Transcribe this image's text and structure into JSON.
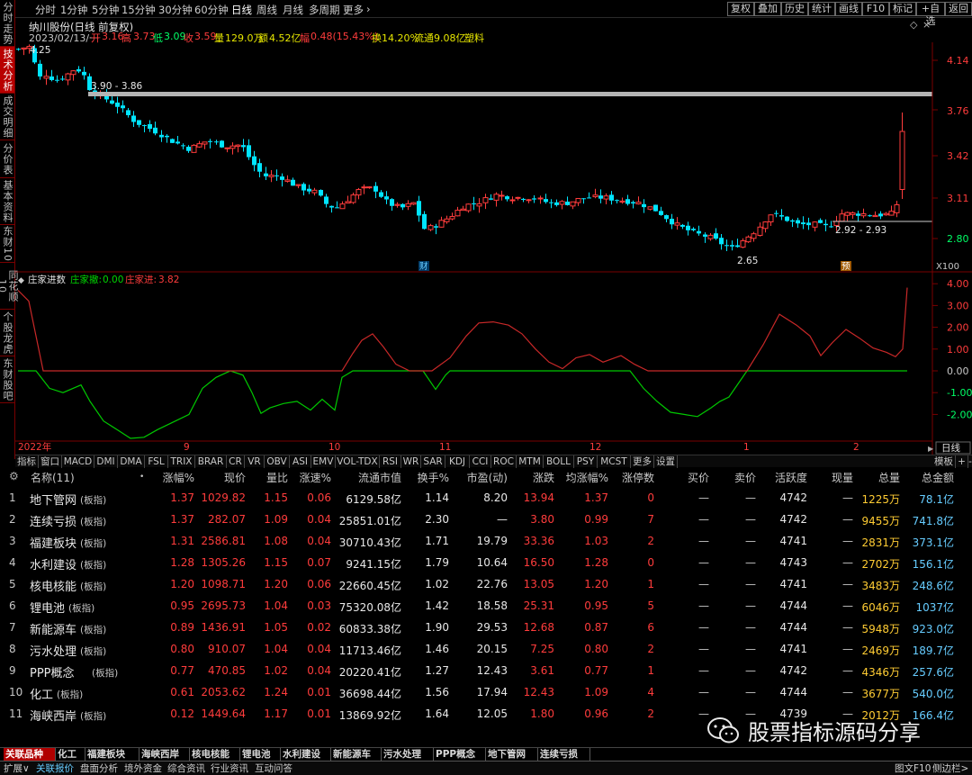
{
  "sidebar": {
    "items": [
      "分时走势",
      "技术分析",
      "成交明细",
      "分价表",
      "基本资料",
      "东财10",
      "同花顺10",
      "个股龙虎",
      "东财股吧"
    ],
    "active_index": 1
  },
  "topbar": {
    "periods": [
      "分时",
      "1分钟",
      "5分钟",
      "15分钟",
      "30分钟",
      "60分钟",
      "日线",
      "周线",
      "月线",
      "多周期",
      "更多"
    ],
    "active_period": "日线",
    "right_buttons": [
      "复权",
      "叠加",
      "历史",
      "统计",
      "画线",
      "F10",
      "标记",
      "+自选",
      "返回"
    ]
  },
  "stock": {
    "title": "纳川股份(日线 前复权)",
    "date": "2023/02/13/一",
    "open_label": "开",
    "open": "3.16",
    "high_label": "高",
    "high": "3.73",
    "low_label": "低",
    "low": "3.09",
    "close_label": "收",
    "close": "3.59",
    "vol_label": "量",
    "vol": "129.0万",
    "amt_label": "额",
    "amt": "4.52亿",
    "chg_label": "幅",
    "chg": "0.48(15.43%)",
    "turnover": "换14.20%",
    "float": "流通9.08亿",
    "industry": "塑料"
  },
  "main_chart": {
    "price_axis": [
      "4.14",
      "3.76",
      "3.42",
      "3.11",
      "2.80"
    ],
    "label_high": "4.25",
    "label_support": "3.90 - 3.86",
    "label_recent": "2.92 - 2.93",
    "label_low": "2.65",
    "marker_cai": "财",
    "marker_yu": "预",
    "zoom": "X100"
  },
  "indicator": {
    "name": "庄家进数",
    "series1_label": "庄家撤:",
    "series1_value": "0.00",
    "series2_label": "庄家进:",
    "series2_value": "3.82",
    "axis": [
      "4.00",
      "3.00",
      "2.00",
      "1.00",
      "0.00",
      "-1.00",
      "-2.00"
    ]
  },
  "time_axis": {
    "labels": [
      "2022年",
      "9",
      "10",
      "11",
      "12",
      "1",
      "2"
    ],
    "right": "日线"
  },
  "indicator_tabs": [
    "指标",
    "窗口",
    "MACD",
    "DMI",
    "DMA",
    "FSL",
    "TRIX",
    "BRAR",
    "CR",
    "VR",
    "OBV",
    "ASI",
    "EMV",
    "VOL-TDX",
    "RSI",
    "WR",
    "SAR",
    "KDJ",
    "CCI",
    "ROC",
    "MTM",
    "BOLL",
    "PSY",
    "MCST",
    "更多",
    "设置"
  ],
  "ind_tab_right": [
    "模板",
    "+",
    "-"
  ],
  "table": {
    "headers": [
      "名称(11)",
      "涨幅%",
      "现价",
      "量比",
      "涨速%",
      "流通市值",
      "换手%",
      "市盈(动)",
      "涨跌",
      "均涨幅%",
      "涨停数",
      "买价",
      "卖价",
      "活跃度",
      "现量",
      "总量",
      "总金额"
    ],
    "rows": [
      [
        "1",
        "地下管网",
        "(板指)",
        "1.37",
        "1029.82",
        "1.15",
        "0.06",
        "6129.58亿",
        "1.14",
        "8.20",
        "13.94",
        "1.37",
        "0",
        "—",
        "—",
        "4742",
        "—",
        "1225万",
        "78.1亿"
      ],
      [
        "2",
        "连续亏损",
        "(板指)",
        "1.37",
        "282.07",
        "1.09",
        "0.04",
        "25851.01亿",
        "2.30",
        "—",
        "3.80",
        "0.99",
        "7",
        "—",
        "—",
        "4742",
        "—",
        "9455万",
        "741.8亿"
      ],
      [
        "3",
        "福建板块",
        "(板指)",
        "1.31",
        "2586.81",
        "1.08",
        "0.04",
        "30710.43亿",
        "1.71",
        "19.79",
        "33.36",
        "1.03",
        "2",
        "—",
        "—",
        "4741",
        "—",
        "2831万",
        "373.1亿"
      ],
      [
        "4",
        "水利建设",
        "(板指)",
        "1.28",
        "1305.26",
        "1.15",
        "0.07",
        "9241.15亿",
        "1.79",
        "10.64",
        "16.50",
        "1.28",
        "0",
        "—",
        "—",
        "4743",
        "—",
        "2702万",
        "156.1亿"
      ],
      [
        "5",
        "核电核能",
        "(板指)",
        "1.20",
        "1098.71",
        "1.20",
        "0.06",
        "22660.45亿",
        "1.02",
        "22.76",
        "13.05",
        "1.20",
        "1",
        "—",
        "—",
        "4741",
        "—",
        "3483万",
        "248.6亿"
      ],
      [
        "6",
        "锂电池",
        "(板指)",
        "0.95",
        "2695.73",
        "1.04",
        "0.03",
        "75320.08亿",
        "1.42",
        "18.58",
        "25.31",
        "0.95",
        "5",
        "—",
        "—",
        "4744",
        "—",
        "6046万",
        "1037亿"
      ],
      [
        "7",
        "新能源车",
        "(板指)",
        "0.89",
        "1436.91",
        "1.05",
        "0.02",
        "60833.38亿",
        "1.90",
        "29.53",
        "12.68",
        "0.87",
        "6",
        "—",
        "—",
        "4744",
        "—",
        "5948万",
        "923.0亿"
      ],
      [
        "8",
        "污水处理",
        "(板指)",
        "0.80",
        "910.07",
        "1.04",
        "0.04",
        "11713.46亿",
        "1.46",
        "20.15",
        "7.25",
        "0.80",
        "2",
        "—",
        "—",
        "4741",
        "—",
        "2469万",
        "189.7亿"
      ],
      [
        "9",
        "PPP概念",
        "(板指)",
        "0.77",
        "470.85",
        "1.02",
        "0.04",
        "20220.41亿",
        "1.27",
        "12.43",
        "3.61",
        "0.77",
        "1",
        "—",
        "—",
        "4742",
        "—",
        "4346万",
        "257.6亿"
      ],
      [
        "10",
        "化工",
        "(板指)",
        "0.61",
        "2053.62",
        "1.24",
        "0.01",
        "36698.44亿",
        "1.56",
        "17.94",
        "12.43",
        "1.09",
        "4",
        "—",
        "—",
        "4744",
        "—",
        "3677万",
        "540.0亿"
      ],
      [
        "11",
        "海峡西岸",
        "(板指)",
        "0.12",
        "1449.64",
        "1.17",
        "0.01",
        "13869.92亿",
        "1.64",
        "12.05",
        "1.80",
        "0.96",
        "2",
        "—",
        "—",
        "4739",
        "—",
        "2012万",
        "166.4亿"
      ]
    ]
  },
  "bottom_tabs": [
    "关联品种",
    "化工",
    "福建板块",
    "海峡西岸",
    "核电核能",
    "锂电池",
    "水利建设",
    "新能源车",
    "污水处理",
    "PPP概念",
    "地下管网",
    "连续亏损"
  ],
  "bottom_bar": [
    "扩展∨",
    "关联报价",
    "盘面分析",
    "境外资金",
    "综合资讯",
    "行业资讯",
    "互动问答"
  ],
  "bottom_right": [
    "图文F10",
    "侧边栏>"
  ],
  "watermark": "股票指标源码分享",
  "colors": {
    "up": "#ff3c3c",
    "down": "#00e5ff",
    "yellow": "#e6e600",
    "green": "#00d800",
    "red_line": "#c82828",
    "gold": "#ffcc33"
  }
}
